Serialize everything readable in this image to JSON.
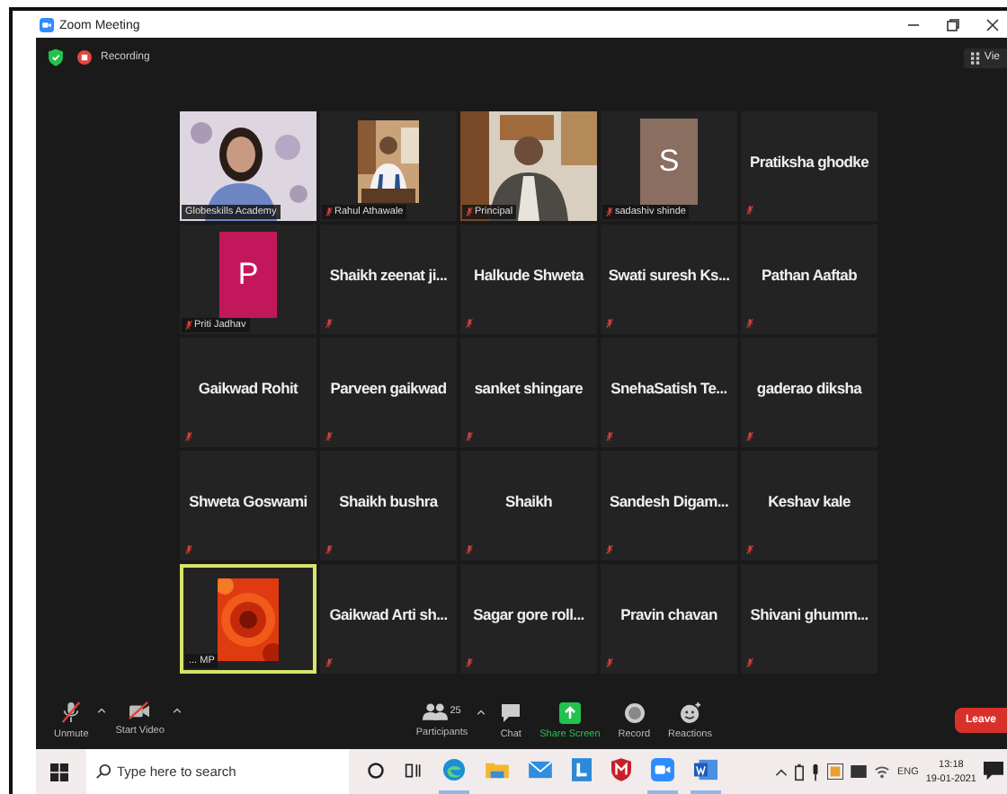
{
  "window": {
    "title": "Zoom Meeting"
  },
  "meeting": {
    "recording_label": "Recording",
    "view_label": "Vie"
  },
  "tiles": [
    {
      "kind": "video",
      "label": "Globeskills Academy",
      "muted": false,
      "speaking": false
    },
    {
      "kind": "video",
      "label": "Rahul Athawale",
      "muted": true,
      "speaking": false
    },
    {
      "kind": "video",
      "label": "Principal",
      "muted": true,
      "speaking": false
    },
    {
      "kind": "avatar",
      "initial": "S",
      "color": "#8a6e60",
      "label": "sadashiv shinde",
      "muted": true,
      "speaking": false
    },
    {
      "kind": "name",
      "name": "Pratiksha ghodke",
      "muted": true,
      "speaking": false
    },
    {
      "kind": "avatar",
      "initial": "P",
      "color": "#c2185b",
      "label": "Priti Jadhav",
      "muted": true,
      "speaking": false
    },
    {
      "kind": "name",
      "name": "Shaikh zeenat ji...",
      "muted": true,
      "speaking": false
    },
    {
      "kind": "name",
      "name": "Halkude Shweta",
      "muted": true,
      "speaking": false
    },
    {
      "kind": "name",
      "name": "Swati suresh Ks...",
      "muted": true,
      "speaking": false
    },
    {
      "kind": "name",
      "name": "Pathan Aaftab",
      "muted": true,
      "speaking": false
    },
    {
      "kind": "name",
      "name": "Gaikwad Rohit",
      "muted": true,
      "speaking": false
    },
    {
      "kind": "name",
      "name": "Parveen gaikwad",
      "muted": true,
      "speaking": false
    },
    {
      "kind": "name",
      "name": "sanket shingare",
      "muted": true,
      "speaking": false
    },
    {
      "kind": "name",
      "name": "SnehaSatish Te...",
      "muted": true,
      "speaking": false
    },
    {
      "kind": "name",
      "name": "gaderao diksha",
      "muted": true,
      "speaking": false
    },
    {
      "kind": "name",
      "name": "Shweta Goswami",
      "muted": true,
      "speaking": false
    },
    {
      "kind": "name",
      "name": "Shaikh bushra",
      "muted": true,
      "speaking": false
    },
    {
      "kind": "name",
      "name": "Shaikh",
      "muted": true,
      "speaking": false
    },
    {
      "kind": "name",
      "name": "Sandesh Digam...",
      "muted": true,
      "speaking": false
    },
    {
      "kind": "name",
      "name": "Keshav kale",
      "muted": true,
      "speaking": false
    },
    {
      "kind": "video",
      "label": "... MP",
      "muted": false,
      "speaking": true
    },
    {
      "kind": "name",
      "name": "Gaikwad Arti sh...",
      "muted": true,
      "speaking": false
    },
    {
      "kind": "name",
      "name": "Sagar gore roll...",
      "muted": true,
      "speaking": false
    },
    {
      "kind": "name",
      "name": "Pravin chavan",
      "muted": true,
      "speaking": false
    },
    {
      "kind": "name",
      "name": "Shivani ghumm...",
      "muted": true,
      "speaking": false
    }
  ],
  "toolbar": {
    "left": [
      {
        "kind": "mic",
        "label": "Unmute"
      },
      {
        "kind": "camera",
        "label": "Start Video"
      }
    ],
    "center": [
      {
        "kind": "participants",
        "label": "Participants",
        "count": "25"
      },
      {
        "kind": "chat",
        "label": "Chat"
      },
      {
        "kind": "share",
        "label": "Share Screen"
      },
      {
        "kind": "record",
        "label": "Record"
      },
      {
        "kind": "reactions",
        "label": "Reactions"
      }
    ],
    "leave_label": "Leave"
  },
  "taskbar": {
    "search": {
      "placeholder": "Type here to search"
    },
    "apps": [
      {
        "kind": "cortana",
        "running": false
      },
      {
        "kind": "taskview",
        "running": false
      },
      {
        "kind": "edge",
        "running": true
      },
      {
        "kind": "folder",
        "running": false
      },
      {
        "kind": "mail",
        "running": false
      },
      {
        "kind": "tile",
        "running": false
      },
      {
        "kind": "shield",
        "running": false
      },
      {
        "kind": "zoom",
        "running": true
      },
      {
        "kind": "word",
        "running": true
      }
    ],
    "language": "ENG",
    "time": "13:18",
    "date": "19-01-2021"
  }
}
